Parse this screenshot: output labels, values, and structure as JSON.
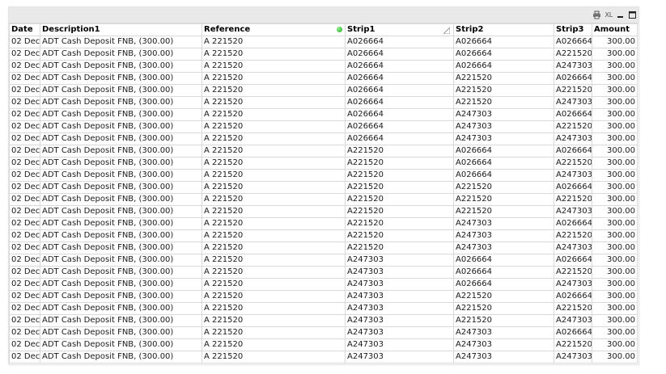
{
  "toolbar": {
    "xl_label": "XL",
    "icons": [
      "print-icon",
      "excel-export-icon",
      "minimize-icon",
      "maximize-icon"
    ]
  },
  "colors": {
    "caption_bg": "#e9e9e9",
    "grid_line": "#d9d9d9",
    "selection_dot": "#1fa81f"
  },
  "columns": [
    "Date",
    "Description1",
    "Reference",
    "Strip1",
    "Strip2",
    "Strip3",
    "Amount"
  ],
  "rows": [
    [
      "02 Dec",
      "ADT Cash Deposit FNB, (300.00)",
      "A 221520",
      "A026664",
      "A026664",
      "A026664",
      "300.00"
    ],
    [
      "02 Dec",
      "ADT Cash Deposit FNB, (300.00)",
      "A 221520",
      "A026664",
      "A026664",
      "A221520",
      "300.00"
    ],
    [
      "02 Dec",
      "ADT Cash Deposit FNB, (300.00)",
      "A 221520",
      "A026664",
      "A026664",
      "A247303",
      "300.00"
    ],
    [
      "02 Dec",
      "ADT Cash Deposit FNB, (300.00)",
      "A 221520",
      "A026664",
      "A221520",
      "A026664",
      "300.00"
    ],
    [
      "02 Dec",
      "ADT Cash Deposit FNB, (300.00)",
      "A 221520",
      "A026664",
      "A221520",
      "A221520",
      "300.00"
    ],
    [
      "02 Dec",
      "ADT Cash Deposit FNB, (300.00)",
      "A 221520",
      "A026664",
      "A221520",
      "A247303",
      "300.00"
    ],
    [
      "02 Dec",
      "ADT Cash Deposit FNB, (300.00)",
      "A 221520",
      "A026664",
      "A247303",
      "A026664",
      "300.00"
    ],
    [
      "02 Dec",
      "ADT Cash Deposit FNB, (300.00)",
      "A 221520",
      "A026664",
      "A247303",
      "A221520",
      "300.00"
    ],
    [
      "02 Dec",
      "ADT Cash Deposit FNB, (300.00)",
      "A 221520",
      "A026664",
      "A247303",
      "A247303",
      "300.00"
    ],
    [
      "02 Dec",
      "ADT Cash Deposit FNB, (300.00)",
      "A 221520",
      "A221520",
      "A026664",
      "A026664",
      "300.00"
    ],
    [
      "02 Dec",
      "ADT Cash Deposit FNB, (300.00)",
      "A 221520",
      "A221520",
      "A026664",
      "A221520",
      "300.00"
    ],
    [
      "02 Dec",
      "ADT Cash Deposit FNB, (300.00)",
      "A 221520",
      "A221520",
      "A026664",
      "A247303",
      "300.00"
    ],
    [
      "02 Dec",
      "ADT Cash Deposit FNB, (300.00)",
      "A 221520",
      "A221520",
      "A221520",
      "A026664",
      "300.00"
    ],
    [
      "02 Dec",
      "ADT Cash Deposit FNB, (300.00)",
      "A 221520",
      "A221520",
      "A221520",
      "A221520",
      "300.00"
    ],
    [
      "02 Dec",
      "ADT Cash Deposit FNB, (300.00)",
      "A 221520",
      "A221520",
      "A221520",
      "A247303",
      "300.00"
    ],
    [
      "02 Dec",
      "ADT Cash Deposit FNB, (300.00)",
      "A 221520",
      "A221520",
      "A247303",
      "A026664",
      "300.00"
    ],
    [
      "02 Dec",
      "ADT Cash Deposit FNB, (300.00)",
      "A 221520",
      "A221520",
      "A247303",
      "A221520",
      "300.00"
    ],
    [
      "02 Dec",
      "ADT Cash Deposit FNB, (300.00)",
      "A 221520",
      "A221520",
      "A247303",
      "A247303",
      "300.00"
    ],
    [
      "02 Dec",
      "ADT Cash Deposit FNB, (300.00)",
      "A 221520",
      "A247303",
      "A026664",
      "A026664",
      "300.00"
    ],
    [
      "02 Dec",
      "ADT Cash Deposit FNB, (300.00)",
      "A 221520",
      "A247303",
      "A026664",
      "A221520",
      "300.00"
    ],
    [
      "02 Dec",
      "ADT Cash Deposit FNB, (300.00)",
      "A 221520",
      "A247303",
      "A026664",
      "A247303",
      "300.00"
    ],
    [
      "02 Dec",
      "ADT Cash Deposit FNB, (300.00)",
      "A 221520",
      "A247303",
      "A221520",
      "A026664",
      "300.00"
    ],
    [
      "02 Dec",
      "ADT Cash Deposit FNB, (300.00)",
      "A 221520",
      "A247303",
      "A221520",
      "A221520",
      "300.00"
    ],
    [
      "02 Dec",
      "ADT Cash Deposit FNB, (300.00)",
      "A 221520",
      "A247303",
      "A221520",
      "A247303",
      "300.00"
    ],
    [
      "02 Dec",
      "ADT Cash Deposit FNB, (300.00)",
      "A 221520",
      "A247303",
      "A247303",
      "A026664",
      "300.00"
    ],
    [
      "02 Dec",
      "ADT Cash Deposit FNB, (300.00)",
      "A 221520",
      "A247303",
      "A247303",
      "A221520",
      "300.00"
    ],
    [
      "02 Dec",
      "ADT Cash Deposit FNB, (300.00)",
      "A 221520",
      "A247303",
      "A247303",
      "A247303",
      "300.00"
    ]
  ]
}
